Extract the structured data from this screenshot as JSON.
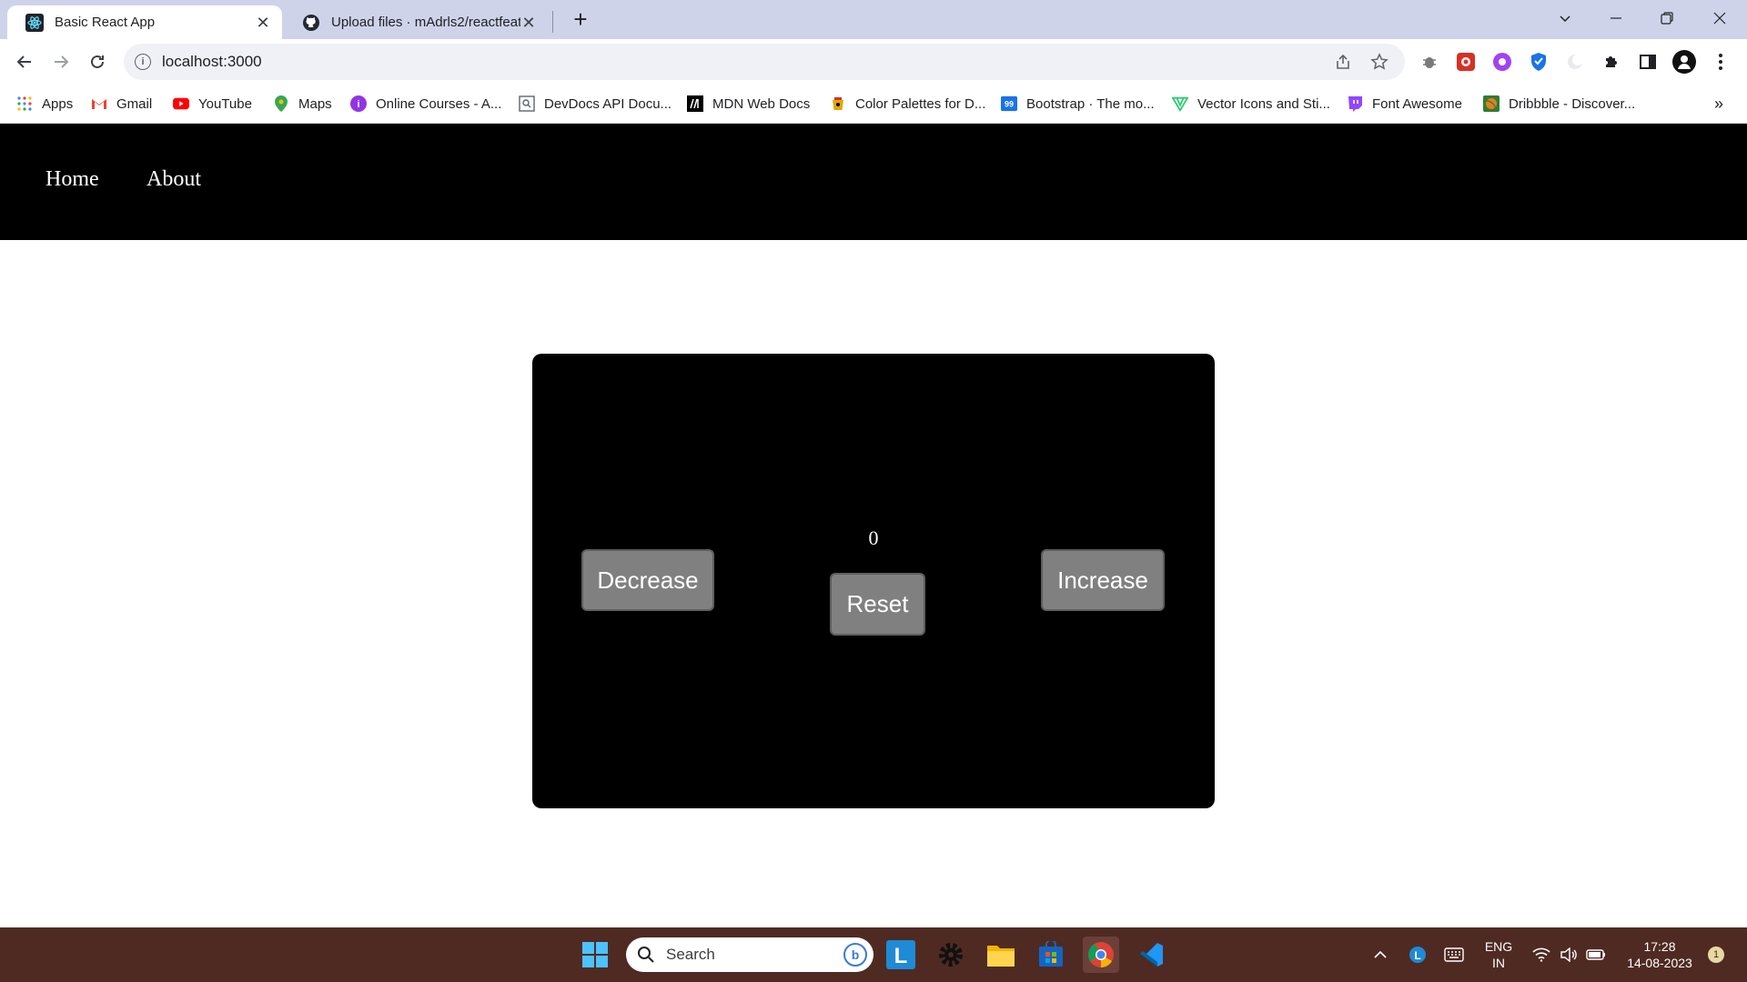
{
  "browser": {
    "tabs": [
      {
        "title": "Basic React App",
        "active": true
      },
      {
        "title": "Upload files · mAdrls2/reactfeatu",
        "active": false
      }
    ],
    "address": "localhost:3000"
  },
  "bookmarks": [
    {
      "label": "Apps",
      "icon": "apps-grid-icon",
      "color": "#4285f4"
    },
    {
      "label": "Gmail",
      "icon": "gmail-icon",
      "color": "#ea4335"
    },
    {
      "label": "YouTube",
      "icon": "youtube-icon",
      "color": "#ff0000"
    },
    {
      "label": "Maps",
      "icon": "maps-pin-icon",
      "color": "#34a853"
    },
    {
      "label": "Online Courses - A...",
      "icon": "courses-icon",
      "color": "#9334e6"
    },
    {
      "label": "DevDocs API Docu...",
      "icon": "devdocs-icon",
      "color": "#5f6368"
    },
    {
      "label": "MDN Web Docs",
      "icon": "mdn-icon",
      "color": "#000000"
    },
    {
      "label": "Color Palettes for D...",
      "icon": "palette-icon",
      "color": "#e0a800"
    },
    {
      "label": "Bootstrap · The mo...",
      "icon": "bootstrap-99-icon",
      "color": "#1a73e8"
    },
    {
      "label": "Vector Icons and Sti...",
      "icon": "vector-icon",
      "color": "#2ecc71"
    },
    {
      "label": "Font Awesome",
      "icon": "twitch-icon",
      "color": "#9146ff"
    },
    {
      "label": "Dribbble - Discover...",
      "icon": "dribbble-icon",
      "color": "#2e7d32"
    }
  ],
  "site": {
    "nav": [
      {
        "label": "Home"
      },
      {
        "label": "About"
      }
    ],
    "counter": {
      "value": "0",
      "decrease_label": "Decrease",
      "reset_label": "Reset",
      "increase_label": "Increase"
    }
  },
  "taskbar": {
    "search_placeholder": "Search",
    "language": "ENG",
    "region": "IN",
    "time": "17:28",
    "date": "14-08-2023",
    "notifications": "1"
  },
  "colors": {
    "tabstrip": "#cfd3ea",
    "taskbar": "#4f2a23",
    "button_gray": "#808080"
  }
}
